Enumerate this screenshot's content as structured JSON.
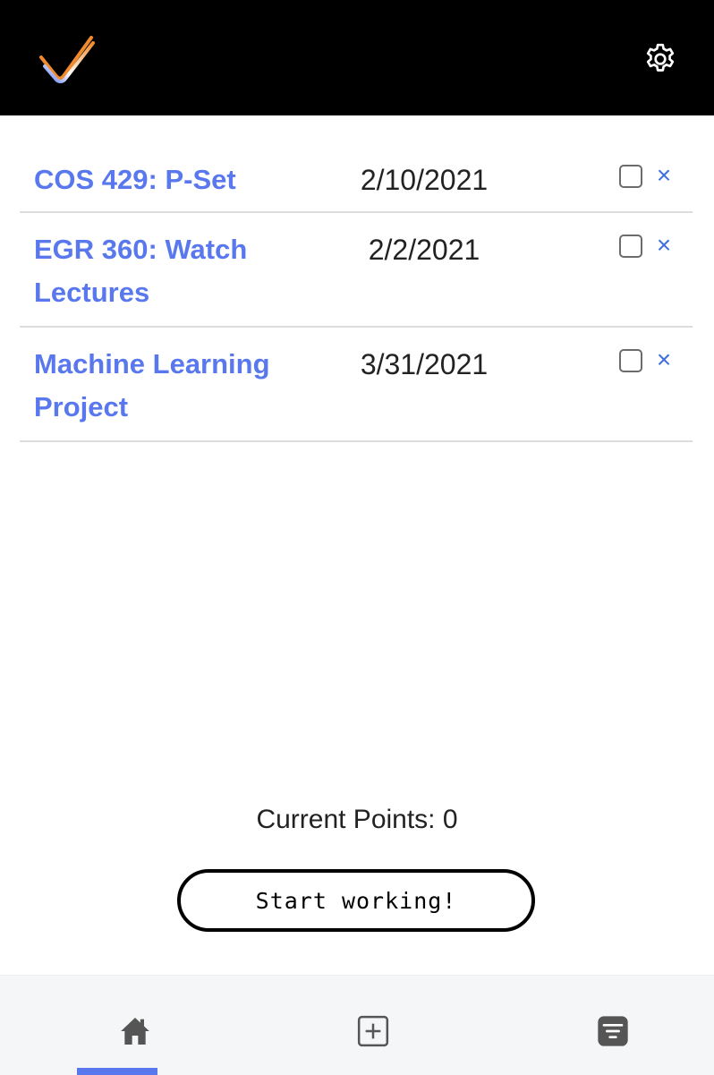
{
  "header": {
    "logo_icon": "checkmark-logo-icon",
    "settings_icon": "gear-icon"
  },
  "tasks": [
    {
      "title": "COS 429: P-Set",
      "date": "2/10/2021",
      "completed": false,
      "delete_label": "×"
    },
    {
      "title": "EGR 360: Watch Lectures",
      "date": "2/2/2021",
      "completed": false,
      "delete_label": "×"
    },
    {
      "title": "Machine Learning Project",
      "date": "3/31/2021",
      "completed": false,
      "delete_label": "×"
    }
  ],
  "points": {
    "text": "Current Points: 0"
  },
  "start_button": {
    "label": "Start working!"
  },
  "nav": {
    "items": [
      {
        "icon": "home-icon",
        "active": true
      },
      {
        "icon": "add-icon",
        "active": false
      },
      {
        "icon": "filter-icon",
        "active": false
      }
    ],
    "accent_color": "#5a78ee"
  },
  "colors": {
    "link": "#5a78ee",
    "delete": "#3d6fdf",
    "header_bg": "#000000"
  }
}
